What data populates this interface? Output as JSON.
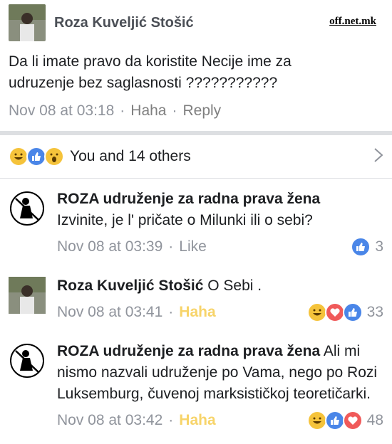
{
  "watermark": "off.net.mk",
  "post": {
    "author": "Roza Kuveljić Stošić",
    "text": "Da li imate pravo da koristite Necije ime za udruzenje bez saglasnosti ???????????",
    "time": "Nov 08 at 03:18",
    "action_haha": "Haha",
    "action_reply": "Reply"
  },
  "reactions_summary": {
    "text": "You and 14 others",
    "icons": [
      "haha-icon",
      "like-icon",
      "wow-icon"
    ]
  },
  "comments": [
    {
      "author": "ROZA udruženje za radna prava žena",
      "text": "Izvinite, je l' pričate o Milunki ili o sebi?",
      "time": "Nov 08 at 03:39",
      "action": "Like",
      "reaction_count": "3",
      "reactions": [
        "like-icon"
      ]
    },
    {
      "author": "Roza Kuveljić Stošić",
      "text": "O Sebi .",
      "time": "Nov 08 at 03:41",
      "action": "Haha",
      "reaction_count": "33",
      "reactions": [
        "haha-icon",
        "love-icon",
        "like-icon"
      ]
    },
    {
      "author": "ROZA udruženje za radna prava žena",
      "text": "Ali mi nismo nazvali udruženje po Vama, nego po Rozi Luksemburg, čuvenoj marksističkoj teoretičarki.",
      "time": "Nov 08 at 03:42",
      "action": "Haha",
      "reaction_count": "48",
      "reactions": [
        "haha-icon",
        "like-icon",
        "love-icon"
      ]
    }
  ],
  "colors": {
    "like": "#4a86e8",
    "love": "#f05a5a",
    "haha": "#f5c33b",
    "haha_action": "#f7d46a",
    "meta": "#90949c"
  }
}
